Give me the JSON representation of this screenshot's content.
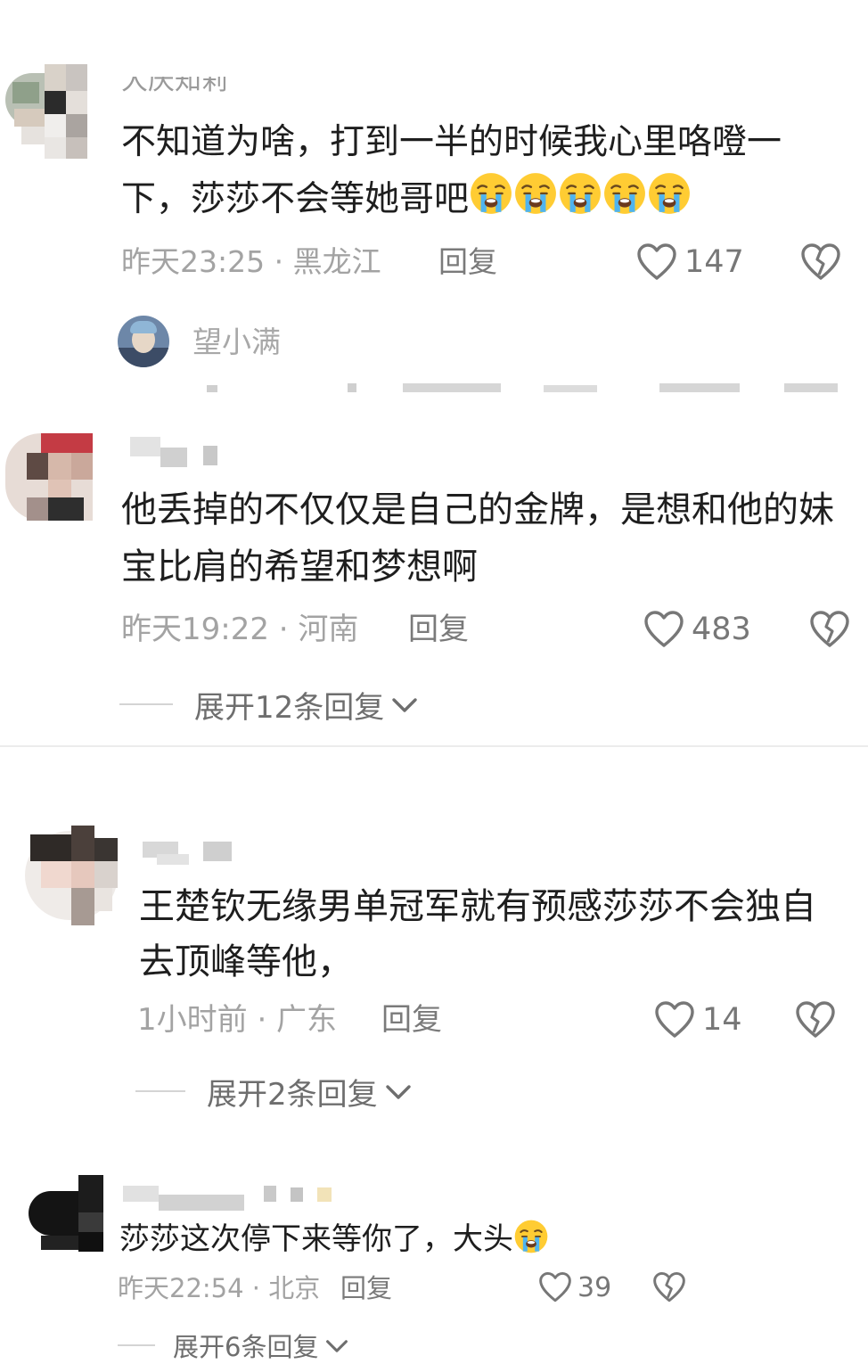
{
  "comments": [
    {
      "username": "大庆知莉",
      "text": "不知道为啥，打到一半的时候我心里咯噔一下，莎莎不会等她哥吧",
      "emoji_count": 5,
      "time_location": "昨天23:25 · 黑龙江",
      "reply_label": "回复",
      "likes": "147"
    },
    {
      "username": "",
      "text": "他丢掉的不仅仅是自己的金牌，是想和他的妹宝比肩的希望和梦想啊",
      "time_location": "昨天19:22 · 河南",
      "reply_label": "回复",
      "likes": "483",
      "expand_label": "展开12条回复"
    },
    {
      "username": "",
      "text": "王楚钦无缘男单冠军就有预感莎莎不会独自去顶峰等他，",
      "time_location": "1小时前 · 广东",
      "reply_label": "回复",
      "likes": "14",
      "expand_label": "展开2条回复"
    },
    {
      "username": "",
      "text": "莎莎这次停下来等你了，大头",
      "emoji_count": 1,
      "time_location": "昨天22:54 · 北京",
      "reply_label": "回复",
      "likes": "39",
      "expand_label": "展开6条回复"
    }
  ],
  "sub_reply": {
    "username": "望小满"
  },
  "icons": {
    "like": "heart-outline-icon",
    "dislike": "broken-heart-icon",
    "expand": "chevron-down-icon",
    "emoji": "crying-face-emoji"
  },
  "colors": {
    "text": "#1e1e1e",
    "meta": "#a3a3a3",
    "icon": "#777777"
  }
}
